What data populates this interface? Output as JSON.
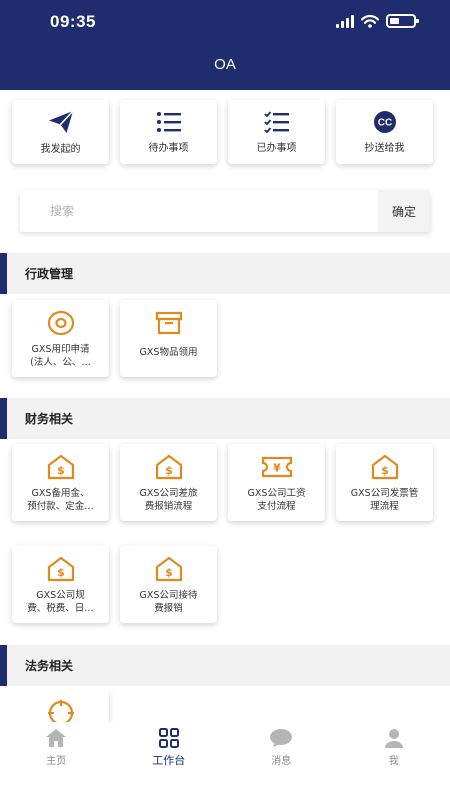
{
  "status_bar": {
    "time": "09:35"
  },
  "header": {
    "title": "OA"
  },
  "quick_actions": [
    {
      "label": "我发起的",
      "icon": "paper-plane-icon"
    },
    {
      "label": "待办事项",
      "icon": "list-icon"
    },
    {
      "label": "已办事项",
      "icon": "checklist-icon"
    },
    {
      "label": "抄送给我",
      "icon": "cc-icon"
    }
  ],
  "search": {
    "placeholder": "搜索",
    "value": "",
    "button_label": "确定"
  },
  "sections": [
    {
      "title": "行政管理",
      "apps": [
        {
          "label": "GXS用印申请\n(法人、公、…",
          "icon": "seal-icon"
        },
        {
          "label": "GXS物品领用",
          "icon": "archive-box-icon"
        }
      ]
    },
    {
      "title": "财务相关",
      "apps": [
        {
          "label": "GXS备用金、\n预付款、定金…",
          "icon": "money-house-icon"
        },
        {
          "label": "GXS公司差旅\n费报销流程",
          "icon": "money-house-icon"
        },
        {
          "label": "GXS公司工资\n支付流程",
          "icon": "yen-ticket-icon"
        },
        {
          "label": "GXS公司发票管\n理流程",
          "icon": "money-house-icon"
        },
        {
          "label": "GXS公司规\n费、税费、日…",
          "icon": "money-house-icon"
        },
        {
          "label": "GXS公司接待\n费报销",
          "icon": "money-house-icon"
        }
      ]
    },
    {
      "title": "法务相关",
      "apps": [
        {
          "label": "",
          "icon": "crosshair-icon"
        }
      ]
    }
  ],
  "tabbar": [
    {
      "label": "主页",
      "icon": "home-icon",
      "active": false
    },
    {
      "label": "工作台",
      "icon": "grid-icon",
      "active": true
    },
    {
      "label": "消息",
      "icon": "chat-bubble-icon",
      "active": false
    },
    {
      "label": "我",
      "icon": "person-icon",
      "active": false
    }
  ],
  "colors": {
    "primary": "#1f2d6e",
    "accent_icon": "#e08a1e",
    "section_bg": "#f2f2f2",
    "inactive_tab": "#b5b5b5"
  }
}
